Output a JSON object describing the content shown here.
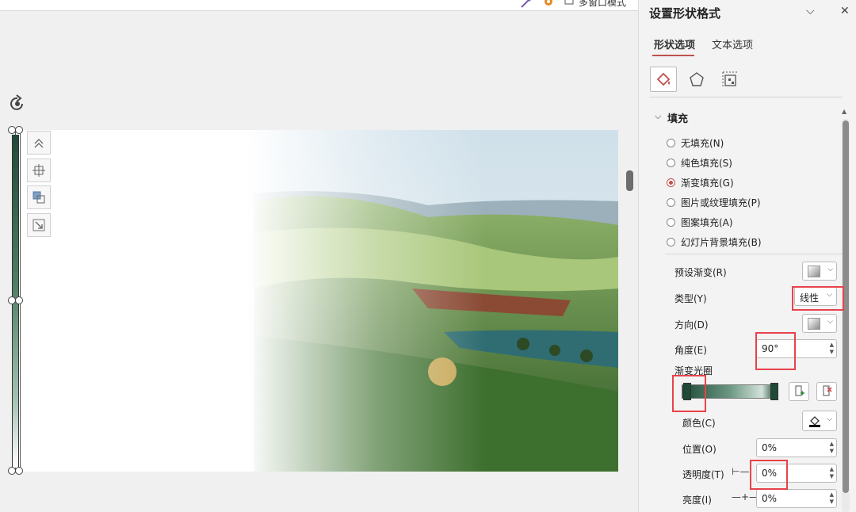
{
  "toolbar": {
    "multi_window": "多窗口模式"
  },
  "panel": {
    "title": "设置形状格式",
    "tabs": [
      {
        "label": "形状选项",
        "active": true
      },
      {
        "label": "文本选项",
        "active": false
      }
    ],
    "icon_tabs": [
      {
        "icon": "fill-bucket-icon",
        "selected": true
      },
      {
        "icon": "pentagon-icon",
        "selected": false
      },
      {
        "icon": "size-position-icon",
        "selected": false
      }
    ],
    "section_title": "填充",
    "fill_options": [
      {
        "label": "无填充(N)",
        "selected": false
      },
      {
        "label": "纯色填充(S)",
        "selected": false
      },
      {
        "label": "渐变填充(G)",
        "selected": true
      },
      {
        "label": "图片或纹理填充(P)",
        "selected": false
      },
      {
        "label": "图案填充(A)",
        "selected": false
      },
      {
        "label": "幻灯片背景填充(B)",
        "selected": false
      }
    ],
    "preset_label": "预设渐变(R)",
    "type_label": "类型(Y)",
    "type_value": "线性",
    "direction_label": "方向(D)",
    "angle_label": "角度(E)",
    "angle_value": "90°",
    "stops_label": "渐变光圈",
    "color_label": "颜色(C)",
    "position_label": "位置(O)",
    "position_value": "0%",
    "transparency_label": "透明度(T)",
    "transparency_value": "0%",
    "brightness_label": "亮度(I)",
    "brightness_value": "0%"
  },
  "colors": {
    "accent": "#c0504d",
    "highlight": "#e8424a",
    "gradient_dark": "#1f4a37"
  }
}
